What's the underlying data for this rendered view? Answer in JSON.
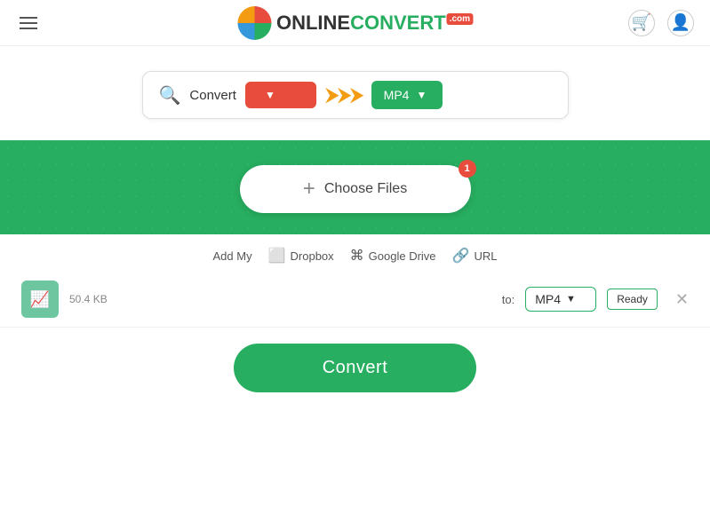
{
  "header": {
    "logo_online": "ONLINE",
    "logo_convert": "CONVERT",
    "logo_com": ".com",
    "cart_label": "cart",
    "user_label": "user"
  },
  "search": {
    "convert_label": "Convert",
    "from_placeholder": "",
    "to_format": "MP4",
    "arrows": "⟹"
  },
  "upload": {
    "choose_files_label": "Choose Files",
    "badge_count": "1",
    "add_my_label": "Add My",
    "dropbox_label": "Dropbox",
    "gdrive_label": "Google Drive",
    "url_label": "URL"
  },
  "file_row": {
    "file_size": "50.4 KB",
    "to_label": "to:",
    "format": "MP4",
    "status": "Ready"
  },
  "convert": {
    "button_label": "Convert"
  }
}
